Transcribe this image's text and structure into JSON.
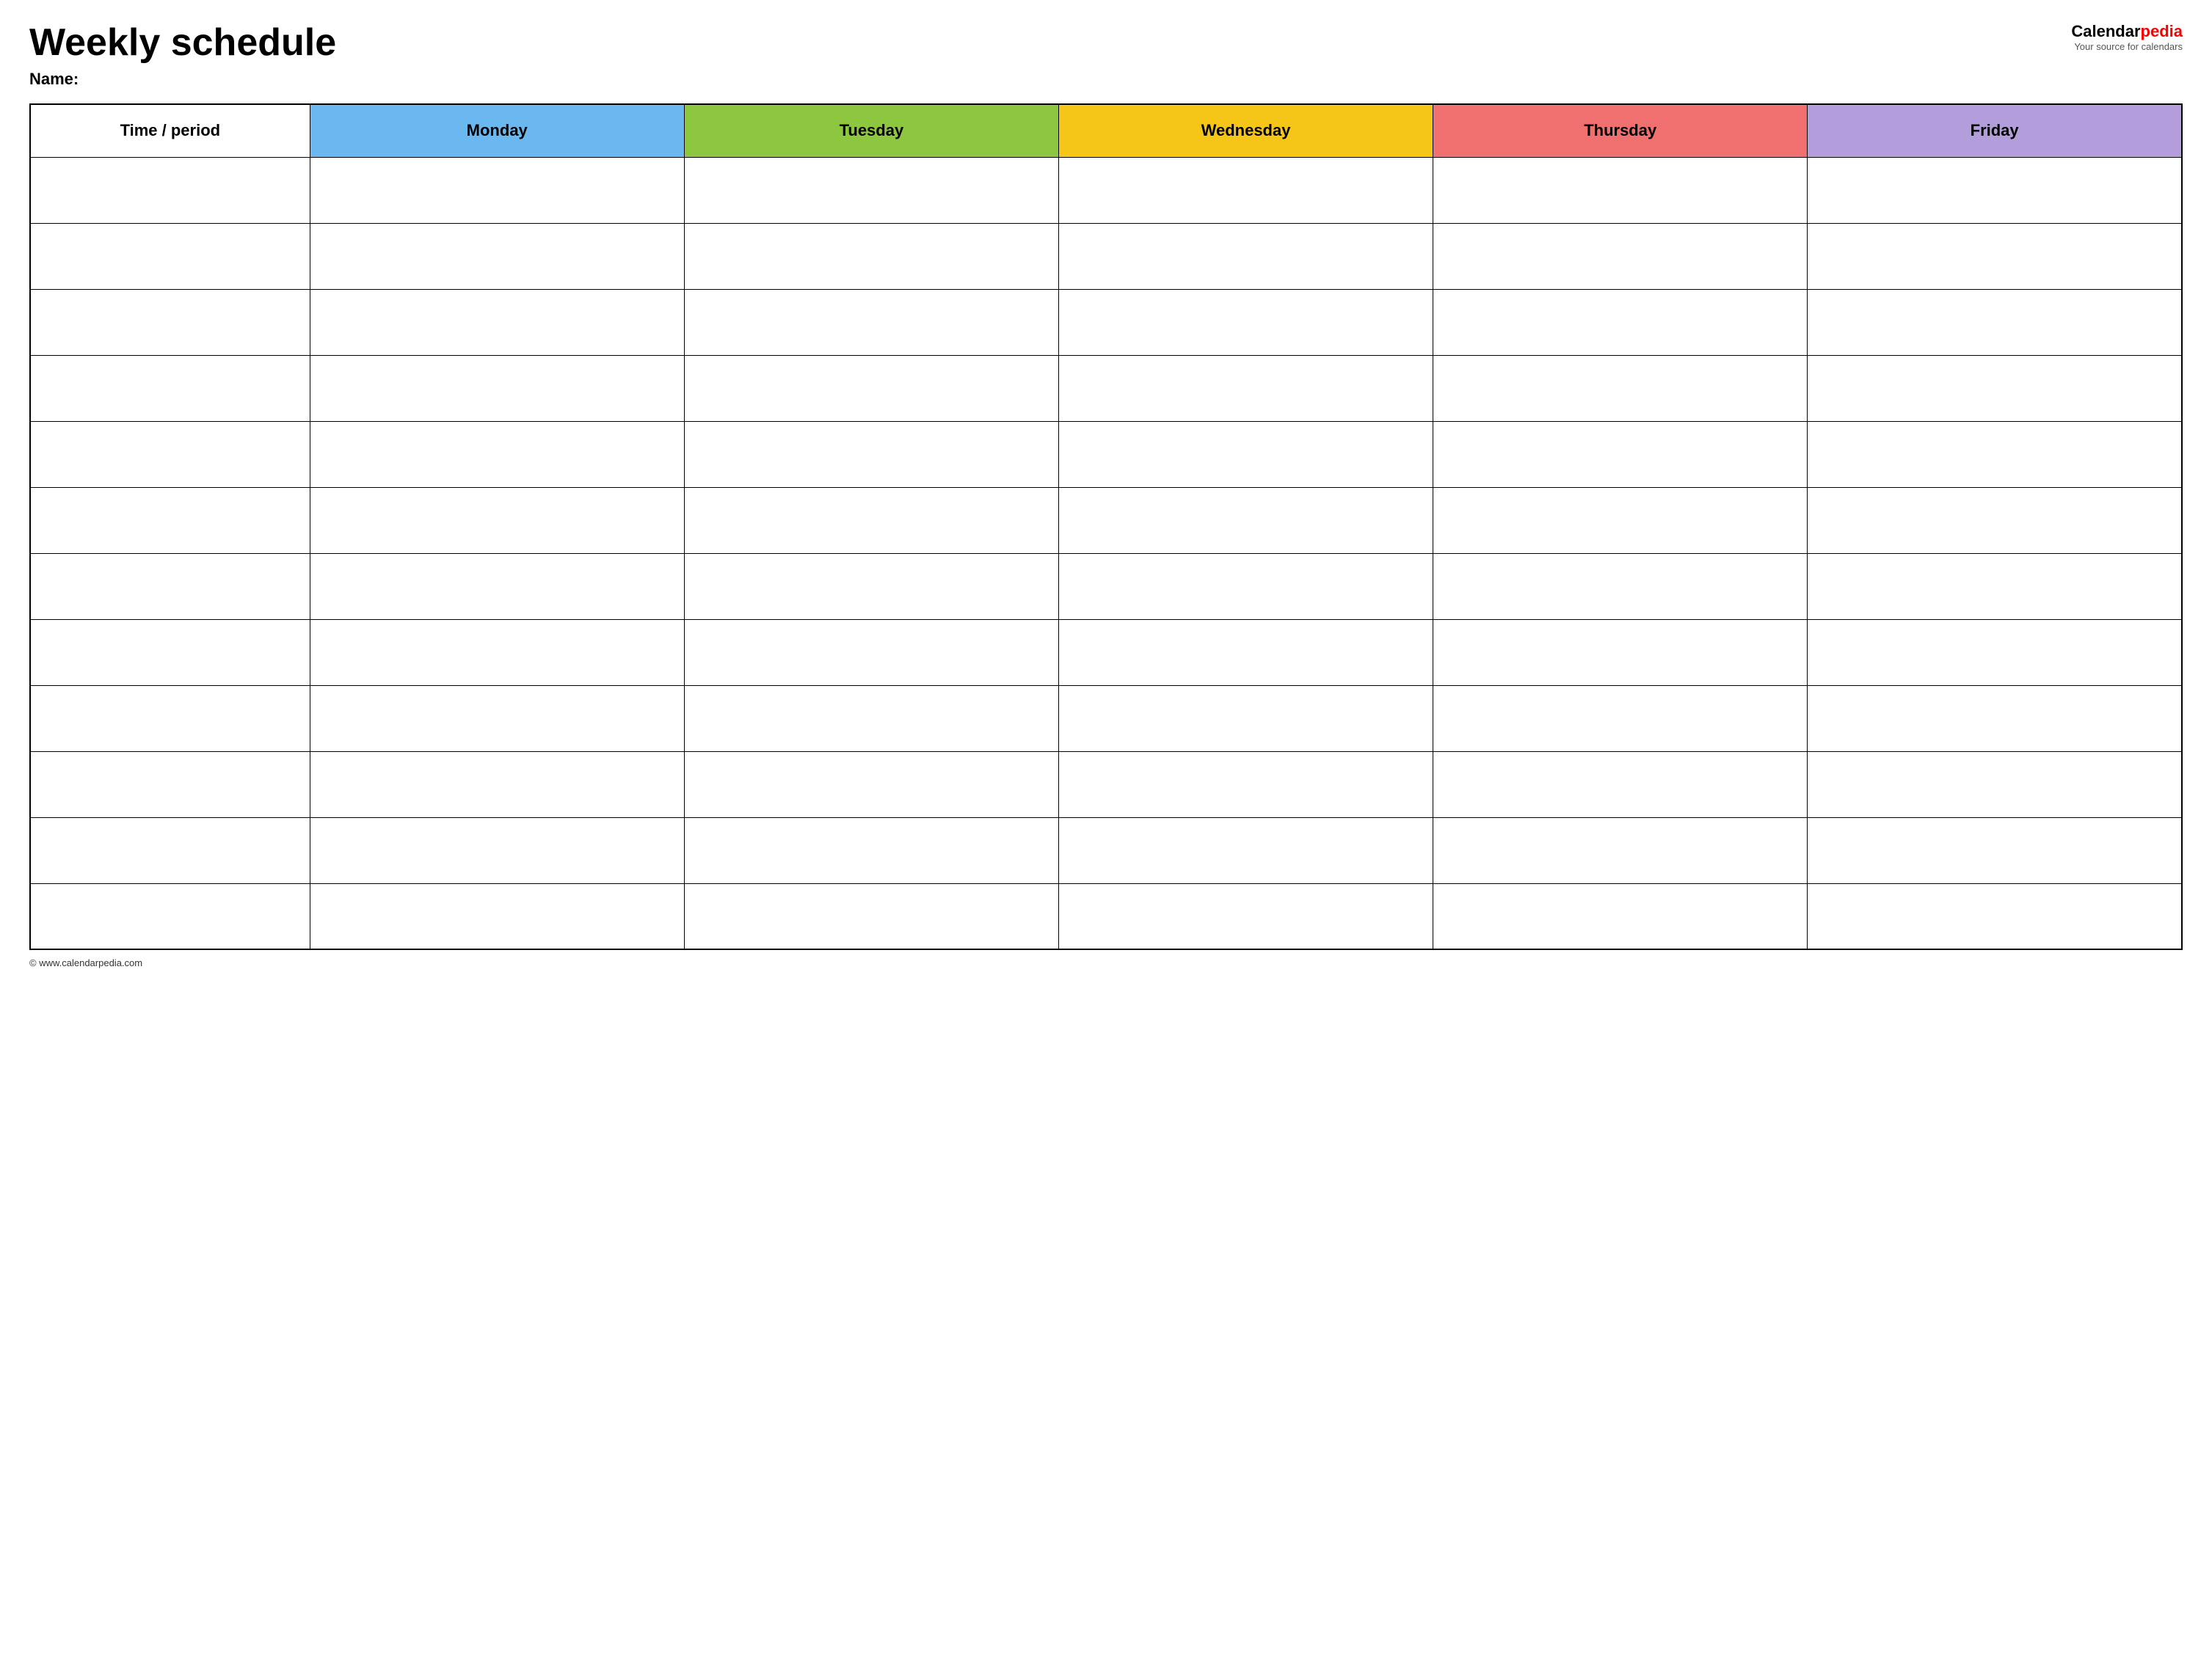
{
  "header": {
    "main_title": "Weekly schedule",
    "name_label": "Name:",
    "logo_calendar": "Calendar",
    "logo_pedia": "pedia",
    "logo_tagline": "Your source for calendars"
  },
  "table": {
    "columns": [
      {
        "id": "time",
        "label": "Time / period",
        "color": "#ffffff"
      },
      {
        "id": "monday",
        "label": "Monday",
        "color": "#6bb8f0"
      },
      {
        "id": "tuesday",
        "label": "Tuesday",
        "color": "#8dc63f"
      },
      {
        "id": "wednesday",
        "label": "Wednesday",
        "color": "#f5c518"
      },
      {
        "id": "thursday",
        "label": "Thursday",
        "color": "#f07070"
      },
      {
        "id": "friday",
        "label": "Friday",
        "color": "#b39ddb"
      }
    ],
    "row_count": 12
  },
  "footer": {
    "copyright": "© www.calendarpedia.com"
  }
}
